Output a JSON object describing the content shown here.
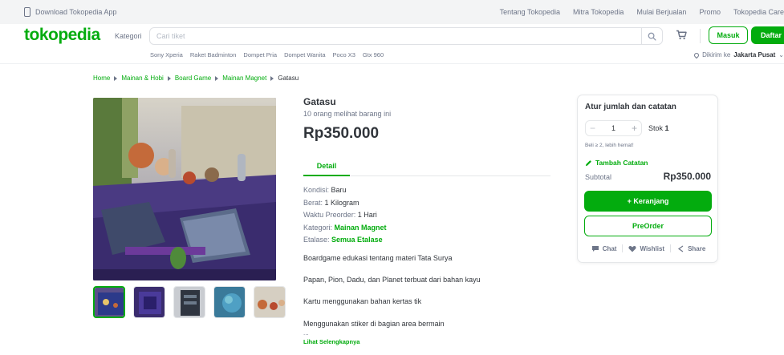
{
  "topbar": {
    "download_app": "Download Tokopedia App",
    "links": [
      "Tentang Tokopedia",
      "Mitra Tokopedia",
      "Mulai Berjualan",
      "Promo",
      "Tokopedia Care"
    ]
  },
  "header": {
    "logo": "tokopedia",
    "kategori": "Kategori",
    "search_placeholder": "Cari tiket",
    "login": "Masuk",
    "register": "Daftar",
    "trending": [
      "Sony Xperia",
      "Raket Badminton",
      "Dompet Pria",
      "Dompet Wanita",
      "Poco X3",
      "Gtx 960"
    ],
    "location_prefix": "Dikirim ke",
    "location": "Jakarta Pusat"
  },
  "breadcrumb": [
    "Home",
    "Mainan & Hobi",
    "Board Game",
    "Mainan Magnet",
    "Gatasu"
  ],
  "product": {
    "title": "Gatasu",
    "seen": "10 orang melihat barang ini",
    "price": "Rp350.000",
    "tab": "Detail",
    "specs": {
      "kondisi_label": "Kondisi:",
      "kondisi": "Baru",
      "berat_label": "Berat:",
      "berat": "1 Kilogram",
      "preorder_label": "Waktu Preorder:",
      "preorder": "1 Hari",
      "kategori_label": "Kategori:",
      "kategori": "Mainan Magnet",
      "etalase_label": "Etalase:",
      "etalase": "Semua Etalase"
    },
    "description": [
      "Boardgame edukasi tentang materi Tata Surya",
      "Papan, Pion, Dadu, dan Planet terbuat dari bahan kayu",
      "Kartu menggunakan bahan kertas tik",
      "Menggunakan stiker di bagian area bermain"
    ],
    "ellipsis": "...",
    "read_more": "Lihat Selengkapnya"
  },
  "purchase_card": {
    "title": "Atur jumlah dan catatan",
    "quantity": "1",
    "stock_label": "Stok",
    "stock": "1",
    "promo": "Beli ≥ 2, lebih hemat!",
    "add_note": "Tambah Catatan",
    "subtotal_label": "Subtotal",
    "subtotal": "Rp350.000",
    "add_to_cart": "+ Keranjang",
    "preorder": "PreOrder",
    "chat": "Chat",
    "wishlist": "Wishlist",
    "share": "Share"
  },
  "colors": {
    "brand": "#03ac0e",
    "text": "#31353b",
    "muted": "#6d7588"
  },
  "icons": [
    "phone-icon",
    "search-icon",
    "cart-icon",
    "location-pin-icon",
    "pencil-icon",
    "chat-icon",
    "heart-icon",
    "share-icon"
  ]
}
